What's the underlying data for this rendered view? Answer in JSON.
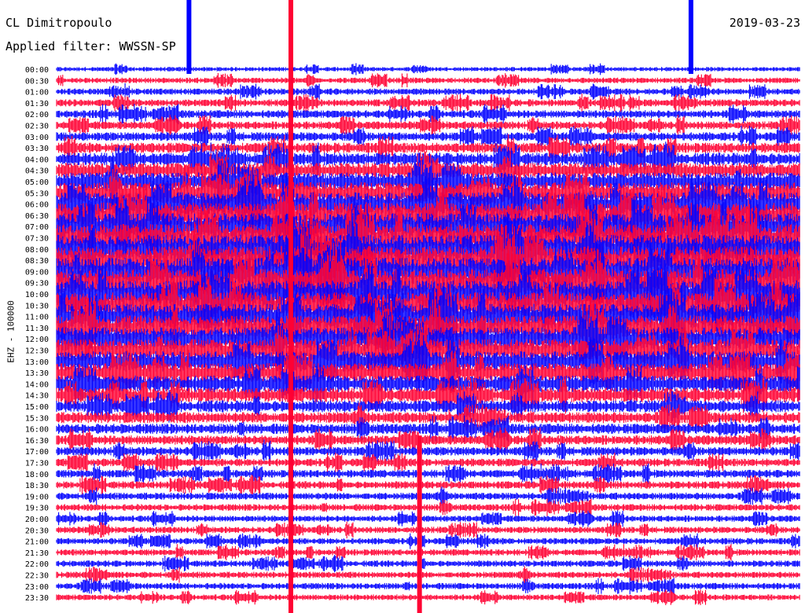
{
  "header": {
    "station": "CL Dimitropoulo",
    "filter": "Applied filter: WWSSN-SP",
    "date": "2019-03-23"
  },
  "colors": {
    "trace_a": "#0000ff",
    "trace_b": "#ff0033",
    "text": "#000000",
    "background": "#ffffff"
  },
  "chart_data": {
    "type": "line",
    "title": "CL Dimitropoulo",
    "subtitle": "Applied filter: WWSSN-SP",
    "date": "2019-03-23",
    "ylabel": "EHZ - 100000",
    "row_labels": [
      "00:00",
      "00:30",
      "01:00",
      "01:30",
      "02:00",
      "02:30",
      "03:00",
      "03:30",
      "04:00",
      "04:30",
      "05:00",
      "05:30",
      "06:00",
      "06:30",
      "07:00",
      "07:30",
      "08:00",
      "08:30",
      "09:00",
      "09:30",
      "10:00",
      "10:30",
      "11:00",
      "11:30",
      "12:00",
      "12:30",
      "13:00",
      "13:30",
      "14:00",
      "14:30",
      "15:00",
      "15:30",
      "16:00",
      "16:30",
      "17:00",
      "17:30",
      "18:00",
      "18:30",
      "19:00",
      "19:30",
      "20:00",
      "20:30",
      "21:00",
      "21:30",
      "22:00",
      "22:30",
      "23:00",
      "23:30"
    ],
    "series_colors": [
      "#0000ff",
      "#ff0033"
    ],
    "row_amplitude": [
      0.55,
      0.7,
      0.8,
      0.9,
      1.0,
      1.0,
      1.1,
      1.3,
      1.6,
      1.9,
      2.3,
      2.7,
      3.0,
      3.2,
      3.4,
      3.5,
      3.6,
      3.6,
      3.5,
      3.5,
      3.4,
      3.3,
      3.2,
      3.1,
      3.0,
      2.8,
      2.6,
      2.4,
      2.1,
      1.8,
      1.5,
      1.4,
      1.3,
      1.2,
      1.1,
      1.0,
      1.0,
      0.95,
      0.9,
      0.85,
      0.8,
      0.8,
      0.8,
      0.8,
      0.8,
      0.8,
      0.8,
      0.75
    ],
    "spikes": [
      {
        "time_fraction": 0.315,
        "rows": "all",
        "color": "#ff0033"
      },
      {
        "time_fraction": 0.488,
        "rows": "17:00-23:30",
        "color": "#ff0033"
      },
      {
        "time_fraction": 0.178,
        "rows": "00:00",
        "color": "#0000ff"
      },
      {
        "time_fraction": 0.853,
        "rows": "00:00",
        "color": "#0000ff"
      }
    ]
  }
}
